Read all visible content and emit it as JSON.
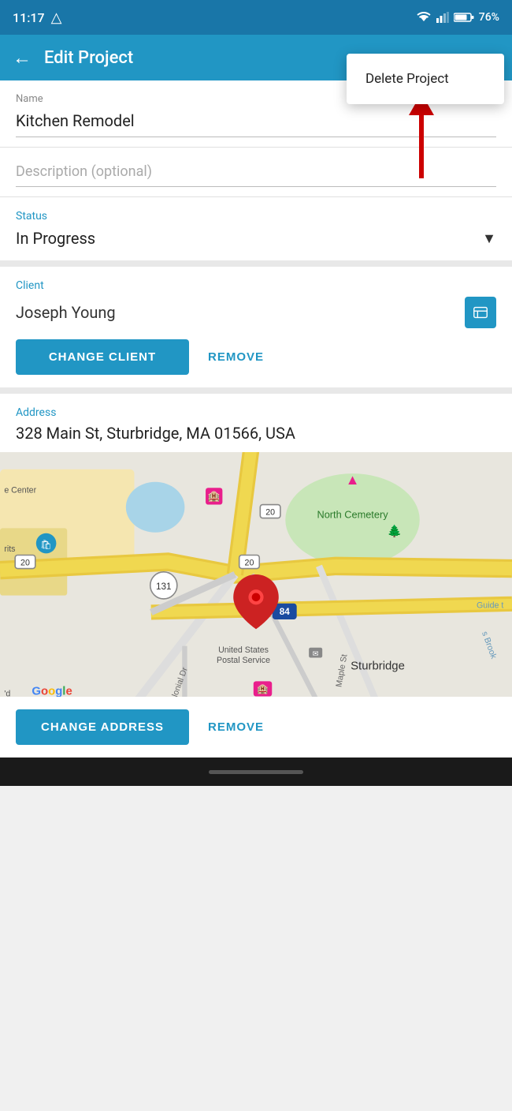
{
  "statusBar": {
    "time": "11:17",
    "battery": "76%"
  },
  "toolbar": {
    "title": "Edit Project",
    "backLabel": "←"
  },
  "popupMenu": {
    "items": [
      {
        "label": "Delete Project"
      }
    ]
  },
  "form": {
    "nameLabel": "Name",
    "nameValue": "Kitchen Remodel",
    "descriptionPlaceholder": "Description (optional)",
    "statusLabel": "Status",
    "statusValue": "In Progress",
    "clientLabel": "Client",
    "clientName": "Joseph Young",
    "changeClientButton": "CHANGE CLIENT",
    "removeClientButton": "REMOVE",
    "addressLabel": "Address",
    "addressValue": "328 Main St, Sturbridge, MA 01566, USA",
    "changeAddressButton": "CHANGE ADDRESS",
    "removeAddressButton": "REMOVE"
  },
  "map": {
    "googleLabel": "Google",
    "locationText": "Sturbridge",
    "postalServiceText": "United States Postal Service"
  },
  "colors": {
    "primary": "#2196c4",
    "statusBar": "#1976a8",
    "arrowRed": "#cc0000"
  }
}
